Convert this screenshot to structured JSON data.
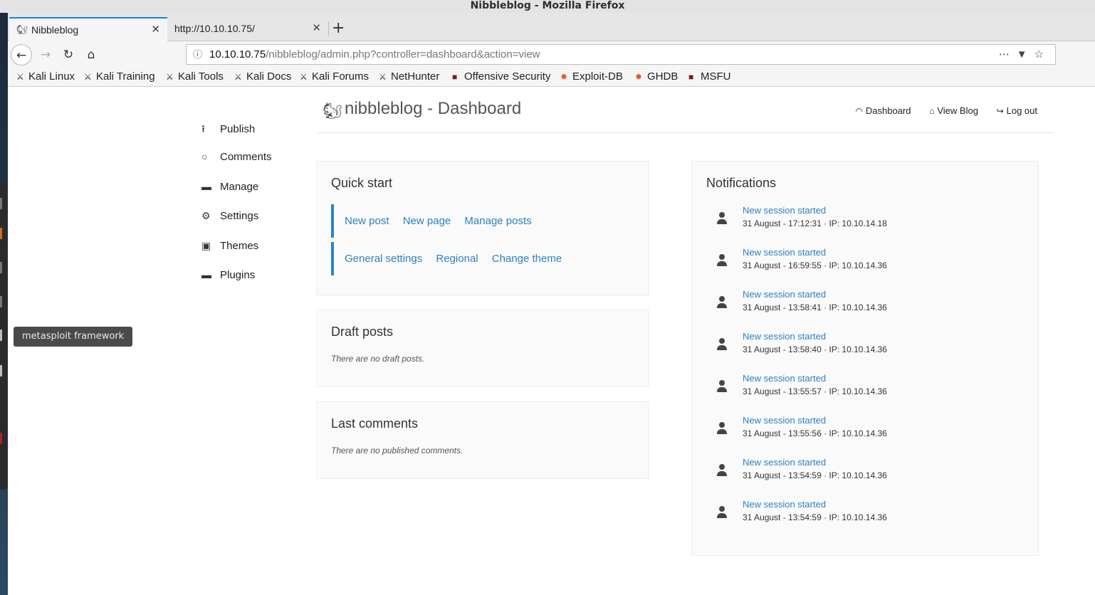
{
  "window": {
    "title": "Nibbleblog - Mozilla Firefox"
  },
  "tabs": [
    {
      "label": "Nibbleblog",
      "active": true
    },
    {
      "label": "http://10.10.10.75/",
      "active": false
    }
  ],
  "url": {
    "host": "10.10.10.75",
    "path": "/nibbleblog/admin.php?controller=dashboard&action=view"
  },
  "bookmarks": [
    {
      "label": "Kali Linux"
    },
    {
      "label": "Kali Training"
    },
    {
      "label": "Kali Tools"
    },
    {
      "label": "Kali Docs"
    },
    {
      "label": "Kali Forums"
    },
    {
      "label": "NetHunter"
    },
    {
      "label": "Offensive Security"
    },
    {
      "label": "Exploit-DB"
    },
    {
      "label": "GHDB"
    },
    {
      "label": "MSFU"
    }
  ],
  "header": {
    "title": "nibbleblog - Dashboard",
    "links": {
      "dashboard": "Dashboard",
      "view_blog": "View Blog",
      "logout": "Log out"
    }
  },
  "sidebar": {
    "items": [
      {
        "label": "Publish",
        "icon": "upload-icon"
      },
      {
        "label": "Comments",
        "icon": "comment-icon"
      },
      {
        "label": "Manage",
        "icon": "folder-icon"
      },
      {
        "label": "Settings",
        "icon": "gear-icon"
      },
      {
        "label": "Themes",
        "icon": "image-icon"
      },
      {
        "label": "Plugins",
        "icon": "folder-icon"
      }
    ]
  },
  "quick_start": {
    "title": "Quick start",
    "row1": {
      "new_post": "New post",
      "new_page": "New page",
      "manage_posts": "Manage posts"
    },
    "row2": {
      "general_settings": "General settings",
      "regional": "Regional",
      "change_theme": "Change theme"
    }
  },
  "draft_posts": {
    "title": "Draft posts",
    "empty": "There are no draft posts."
  },
  "last_comments": {
    "title": "Last comments",
    "empty": "There are no published comments."
  },
  "notifications": {
    "title": "Notifications",
    "items": [
      {
        "title": "New session started",
        "meta": "31 August - 17:12:31 · IP: 10.10.14.18"
      },
      {
        "title": "New session started",
        "meta": "31 August - 16:59:55 · IP: 10.10.14.36"
      },
      {
        "title": "New session started",
        "meta": "31 August - 13:58:41 · IP: 10.10.14.36"
      },
      {
        "title": "New session started",
        "meta": "31 August - 13:58:40 · IP: 10.10.14.36"
      },
      {
        "title": "New session started",
        "meta": "31 August - 13:55:57 · IP: 10.10.14.36"
      },
      {
        "title": "New session started",
        "meta": "31 August - 13:55:56 · IP: 10.10.14.36"
      },
      {
        "title": "New session started",
        "meta": "31 August - 13:54:59 · IP: 10.10.14.36"
      },
      {
        "title": "New session started",
        "meta": "31 August - 13:54:59 · IP: 10.10.14.36"
      }
    ]
  },
  "tooltip": {
    "text": "metasploit framework"
  },
  "colors": {
    "link": "#2b82c4",
    "tab_accent": "#0a84ff"
  }
}
